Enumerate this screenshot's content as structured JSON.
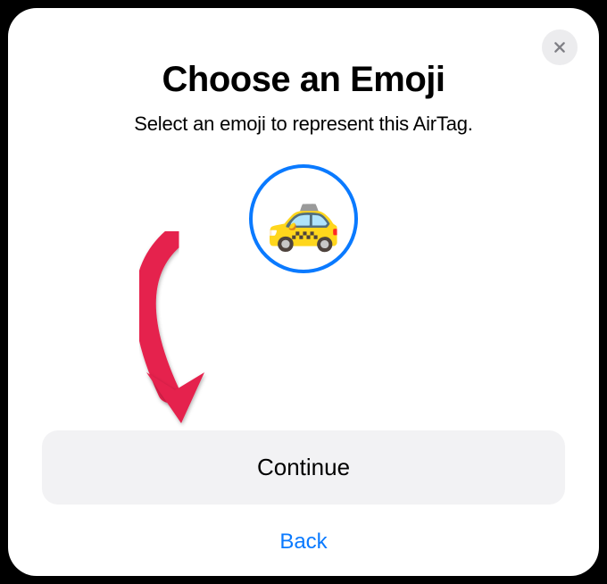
{
  "modal": {
    "title": "Choose an Emoji",
    "subtitle": "Select an emoji to represent this AirTag.",
    "selected_emoji": "🚕",
    "continue_label": "Continue",
    "back_label": "Back"
  },
  "colors": {
    "accent": "#0a7aff",
    "button_bg": "#f2f2f4",
    "arrow": "#e5224d"
  }
}
